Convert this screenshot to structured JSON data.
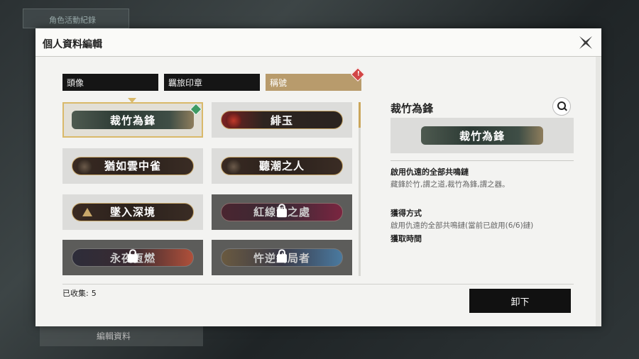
{
  "background": {
    "top_left_label": "角色活動紀錄",
    "bottom_button_label": "編輯資料"
  },
  "modal": {
    "title": "個人資料編輯",
    "close_icon": "close-x-icon"
  },
  "tabs": [
    {
      "label": "頭像",
      "active": false
    },
    {
      "label": "羈旅印章",
      "active": false
    },
    {
      "label": "稱號",
      "active": true,
      "has_alert": true
    }
  ],
  "titles": [
    {
      "label": "裁竹為鋒",
      "locked": false,
      "selected": true,
      "equipped": true
    },
    {
      "label": "緋玉",
      "locked": false
    },
    {
      "label": "猶如雲中雀",
      "locked": false
    },
    {
      "label": "聽潮之人",
      "locked": false
    },
    {
      "label": "墜入深境",
      "locked": false
    },
    {
      "label": "紅線繫之處",
      "locked": true
    },
    {
      "label": "永夜恆燃",
      "locked": true
    },
    {
      "label": "忤逆終局者",
      "locked": true
    }
  ],
  "collected": {
    "label": "已收集:",
    "count": "5"
  },
  "detail": {
    "title": "裁竹為鋒",
    "preview_label": "裁竹為鋒",
    "condition_heading": "啟用仇遠的全部共鳴鏈",
    "flavor_text": "藏鋒於竹,謂之道,裁竹為鋒,謂之器。",
    "obtain_heading": "獲得方式",
    "obtain_text": "啟用仇遠的全部共鳴鏈(當前已啟用(6/6)鏈)",
    "time_heading": "獲取時間"
  },
  "unequip_label": "卸下"
}
